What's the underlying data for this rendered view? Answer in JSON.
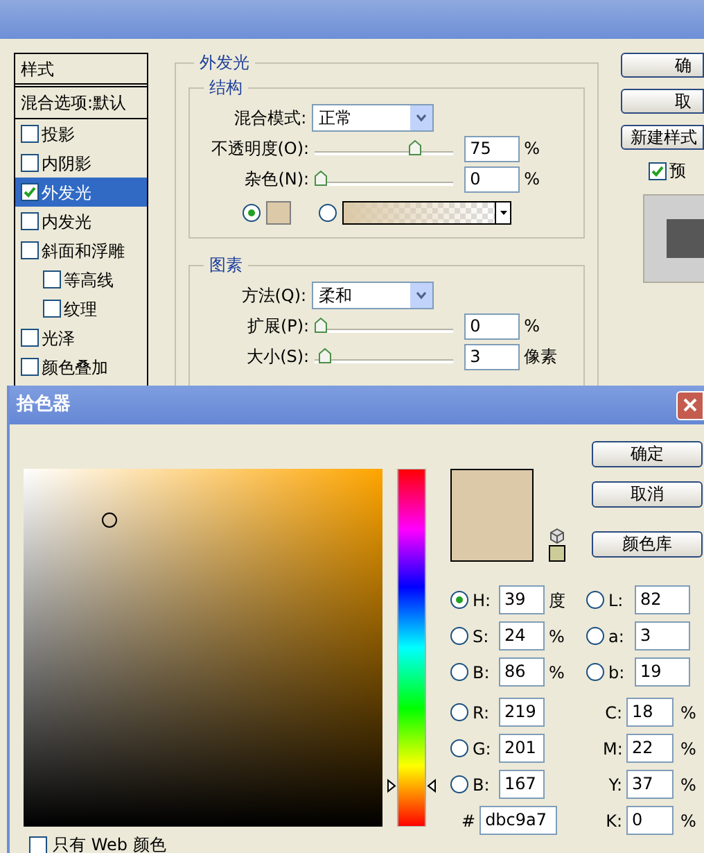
{
  "layer_style": {
    "styles_list": {
      "header": "样式",
      "items": [
        {
          "kind": "option",
          "label": "混合选项:默认",
          "selected": false
        },
        {
          "kind": "checkbox",
          "label": "投影",
          "checked": false,
          "selected": false
        },
        {
          "kind": "checkbox",
          "label": "内阴影",
          "checked": false,
          "selected": false
        },
        {
          "kind": "checkbox",
          "label": "外发光",
          "checked": true,
          "selected": true
        },
        {
          "kind": "checkbox",
          "label": "内发光",
          "checked": false,
          "selected": false
        },
        {
          "kind": "checkbox",
          "label": "斜面和浮雕",
          "checked": false,
          "selected": false,
          "children": [
            {
              "kind": "checkbox",
              "label": "等高线",
              "checked": false,
              "selected": false
            },
            {
              "kind": "checkbox",
              "label": "纹理",
              "checked": false,
              "selected": false
            }
          ]
        },
        {
          "kind": "checkbox",
          "label": "光泽",
          "checked": false,
          "selected": false
        },
        {
          "kind": "checkbox",
          "label": "颜色叠加",
          "checked": false,
          "selected": false
        }
      ]
    },
    "panel": {
      "title": "外发光",
      "structure": {
        "title": "结构",
        "rows": [
          {
            "kind": "dropdown",
            "label": "混合模式:",
            "value": "正常"
          },
          {
            "kind": "slider",
            "label": "不透明度(O):",
            "level": 0.75,
            "value": "75",
            "unit": "%"
          },
          {
            "kind": "slider",
            "label": "杂色(N):",
            "level": 0,
            "value": "0",
            "unit": "%"
          },
          {
            "kind": "fill",
            "options": [
              {
                "kind": "color",
                "selected": true,
                "color": "#dbc9a7"
              },
              {
                "kind": "gradient",
                "selected": false,
                "color": "#dbc9a7"
              }
            ]
          }
        ]
      },
      "elements": {
        "title": "图素",
        "rows": [
          {
            "kind": "dropdown",
            "label": "方法(Q):",
            "value": "柔和"
          },
          {
            "kind": "slider",
            "label": "扩展(P):",
            "level": 0,
            "value": "0",
            "unit": "%"
          },
          {
            "kind": "slider",
            "label": "大小(S):",
            "level": 0.03,
            "value": "3",
            "unit": "像素"
          }
        ]
      }
    },
    "buttons": [
      "确",
      "取",
      "新建样式"
    ],
    "preview": {
      "label": "预",
      "checked": true
    }
  },
  "color_picker": {
    "title": "拾色器",
    "buttons": [
      "确定",
      "取消",
      "颜色库"
    ],
    "hsb": [
      {
        "label": "H:",
        "value": "39",
        "unit": "度",
        "selected": true
      },
      {
        "label": "S:",
        "value": "24",
        "unit": "%",
        "selected": false
      },
      {
        "label": "B:",
        "value": "86",
        "unit": "%",
        "selected": false
      }
    ],
    "lab": [
      {
        "label": "L:",
        "value": "82",
        "selected": false
      },
      {
        "label": "a:",
        "value": "3",
        "selected": false
      },
      {
        "label": "b:",
        "value": "19",
        "selected": false
      }
    ],
    "rgb": [
      {
        "label": "R:",
        "value": "219",
        "selected": false
      },
      {
        "label": "G:",
        "value": "201",
        "selected": false
      },
      {
        "label": "B:",
        "value": "167",
        "selected": false
      }
    ],
    "cmyk": [
      {
        "label": "C:",
        "value": "18",
        "unit": "%"
      },
      {
        "label": "M:",
        "value": "22",
        "unit": "%"
      },
      {
        "label": "Y:",
        "value": "37",
        "unit": "%"
      },
      {
        "label": "K:",
        "value": "0",
        "unit": "%"
      }
    ],
    "hex": {
      "label": "#",
      "value": "dbc9a7"
    },
    "hue_slider": {
      "level": 0.108
    },
    "web_only": {
      "label": "只有 Web 颜色",
      "checked": false
    }
  }
}
